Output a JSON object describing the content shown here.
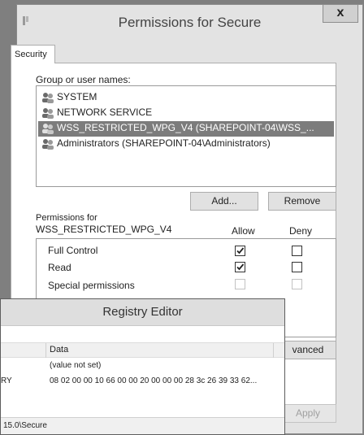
{
  "permissions_dialog": {
    "title": "Permissions for Secure",
    "close_glyph": "x",
    "tab_label": "Security",
    "group_label": "Group or user names:",
    "users": [
      {
        "name": "SYSTEM",
        "icon": "users-icon",
        "selected": false
      },
      {
        "name": "NETWORK SERVICE",
        "icon": "users-icon",
        "selected": false
      },
      {
        "name": "WSS_RESTRICTED_WPG_V4 (SHAREPOINT-04\\WSS_...",
        "icon": "users-icon",
        "selected": true
      },
      {
        "name": "Administrators (SHAREPOINT-04\\Administrators)",
        "icon": "users-icon",
        "selected": false
      }
    ],
    "add_label": "Add...",
    "remove_label": "Remove",
    "perm_label_line1": "Permissions for",
    "perm_label_line2": "WSS_RESTRICTED_WPG_V4",
    "allow_header": "Allow",
    "deny_header": "Deny",
    "permissions": [
      {
        "name": "Full Control",
        "allow": true,
        "deny": false,
        "disabled": false
      },
      {
        "name": "Read",
        "allow": true,
        "deny": false,
        "disabled": false
      },
      {
        "name": "Special permissions",
        "allow": false,
        "deny": false,
        "disabled": true
      }
    ],
    "advanced_label": "vanced",
    "apply_label": "Apply",
    "selection_color": "#7c7c7c"
  },
  "registry_editor": {
    "title": "Registry Editor",
    "data_header": "Data",
    "rows": [
      {
        "type_frag": "",
        "data": "(value not set)"
      },
      {
        "type_frag": "RY",
        "data": "08 02 00 00 10 66 00 00 20 00 00 00 28 3c 26 39 33 62..."
      }
    ],
    "status_path": "15.0\\Secure"
  }
}
